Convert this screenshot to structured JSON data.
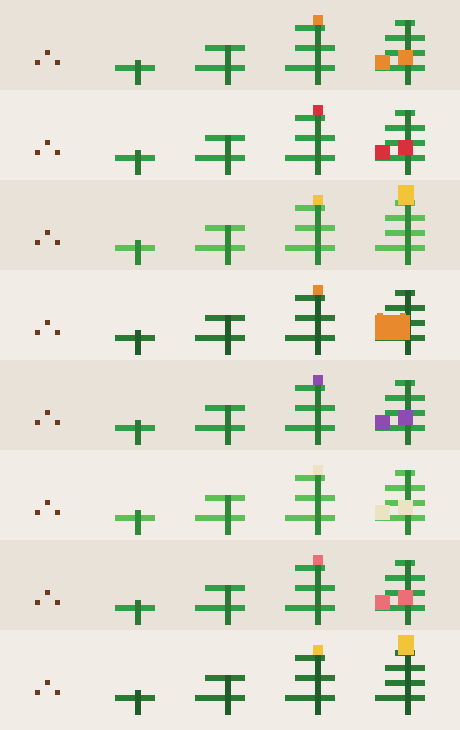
{
  "sheet": {
    "palette": {
      "bg_light": "#f1ede6",
      "bg_dark": "#e8e2d8",
      "seed": "#6b3a1f"
    },
    "stages": [
      "seed",
      "sprout",
      "young",
      "budding",
      "mature"
    ],
    "plants": [
      {
        "id": "carrot",
        "leaf": "#2fa048",
        "stem": "#2a7a36",
        "fruit": "#e8892e",
        "bud": "#e8892e",
        "fruit_shape": "twin"
      },
      {
        "id": "tomato",
        "leaf": "#2fa048",
        "stem": "#2a7a36",
        "fruit": "#d9303d",
        "bud": "#d9303d",
        "fruit_shape": "twin"
      },
      {
        "id": "corn",
        "leaf": "#5cbf58",
        "stem": "#2f8a3a",
        "fruit": "#f2c43a",
        "bud": "#f2c43a",
        "fruit_shape": "cob"
      },
      {
        "id": "pumpkin",
        "leaf": "#2a7a36",
        "stem": "#1f5e2a",
        "fruit": "#e8892e",
        "bud": "#e8892e",
        "fruit_shape": "gourd"
      },
      {
        "id": "eggplant",
        "leaf": "#2fa048",
        "stem": "#2a7a36",
        "fruit": "#8e4bb0",
        "bud": "#8e4bb0",
        "fruit_shape": "twin"
      },
      {
        "id": "cauliflower",
        "leaf": "#5cbf58",
        "stem": "#2f8a3a",
        "fruit": "#ece3c2",
        "bud": "#ece3c2",
        "fruit_shape": "twin"
      },
      {
        "id": "radish",
        "leaf": "#2fa048",
        "stem": "#2a7a36",
        "fruit": "#ec6f78",
        "bud": "#ec6f78",
        "fruit_shape": "twin"
      },
      {
        "id": "wheat",
        "leaf": "#2a7a36",
        "stem": "#1f5e2a",
        "fruit": "#f2c43a",
        "bud": "#f2c43a",
        "fruit_shape": "cob"
      }
    ]
  }
}
